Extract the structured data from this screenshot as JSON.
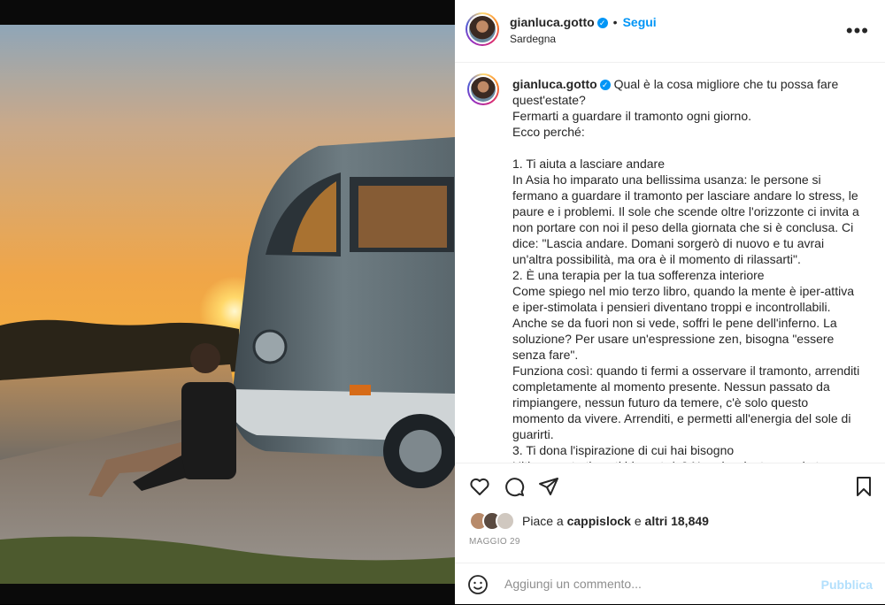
{
  "header": {
    "username": "gianluca.gotto",
    "follow_label": "Segui",
    "separator": "•",
    "location": "Sardegna",
    "more_icon": "more-horizontal-icon"
  },
  "caption": {
    "username": "gianluca.gotto",
    "text": "Qual è la cosa migliore che tu possa fare quest'estate?\nFermarti a guardare il tramonto ogni giorno.\nEcco perché:\n\n1. Ti aiuta a lasciare andare\nIn Asia ho imparato una bellissima usanza: le persone si fermano a guardare il tramonto per lasciare andare lo stress, le paure e i problemi. Il sole che scende oltre l'orizzonte ci invita a non portare con noi il peso della giornata che si è conclusa. Ci dice: \"Lascia andare. Domani sorgerò di nuovo e tu avrai un'altra possibilità, ma ora è il momento di rilassarti\".\n2. È una terapia per la tua sofferenza interiore\nCome spiego nel mio terzo libro, quando la mente è iper-attiva e iper-stimolata i pensieri diventano troppi e incontrollabili. Anche se da fuori non si vede, soffri le pene dell'inferno. La soluzione? Per usare un'espressione zen, bisogna \"essere senza fare\".\nFunziona così: quando ti fermi a osservare il tramonto, arrenditi completamente al momento presente. Nessun passato da rimpiangere, nessun futuro da temere, c'è solo questo momento da vivere. Arrenditi, e permetti all'energia del sole di guarirti.\n3. Ti dona l'ispirazione di cui hai bisogno\nUltimamente ti senti bloccato/a? Non riesci a trovare la tua strada, ad andare avanti con la tua tesi di laurea, il tuo libro, il tuo sogno, il tuo lavoro? Hai bisogno di una sola cosa: rallentare."
  },
  "actions": {
    "icons": [
      "heart-icon",
      "comment-icon",
      "share-icon",
      "bookmark-icon"
    ]
  },
  "likes": {
    "prefix": "Piace a",
    "user": "cappislock",
    "connector": "e",
    "others": "altri 18,849"
  },
  "date": "MAGGIO 29",
  "comment_box": {
    "placeholder": "Aggiungi un commento...",
    "publish_label": "Pubblica",
    "emoji_icon": "emoji-icon"
  },
  "colors": {
    "accent": "#0095f6",
    "publish_disabled": "#b2dffc",
    "text": "#262626",
    "muted": "#8e8e8e"
  }
}
